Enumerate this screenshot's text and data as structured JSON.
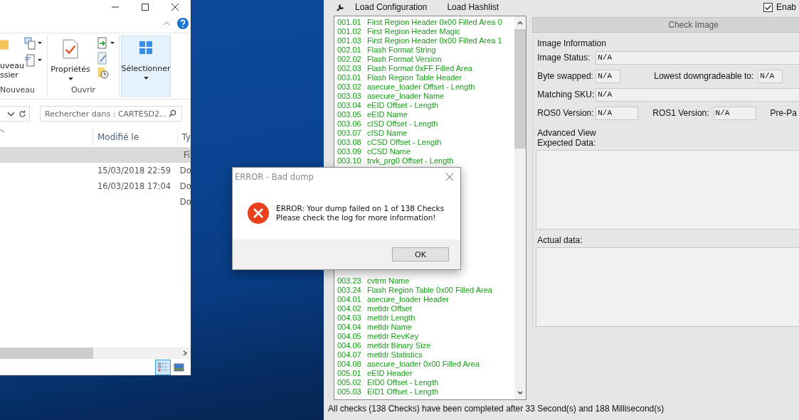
{
  "explorer": {
    "new_folder": "uveau\nssier",
    "groups": [
      {
        "label": "Nouveau"
      },
      {
        "label": "Ouvrir"
      }
    ],
    "properties": "Propriétés",
    "select": "Sélectionner",
    "search": {
      "placeholder": "Rechercher dans : CARTESD2..."
    },
    "columns": [
      "Modifié le",
      "Ty"
    ],
    "rows": [
      {
        "modified": "",
        "type": "Fi",
        "selected": true
      },
      {
        "modified": "15/03/2018 22:59",
        "type": "Do",
        "selected": false
      },
      {
        "modified": "16/03/2018 17:04",
        "type": "Do",
        "selected": false
      },
      {
        "modified": "",
        "type": "Do",
        "selected": false
      }
    ]
  },
  "app": {
    "toolbar": [
      "Load Configuration",
      "Load Hashlist"
    ],
    "option": {
      "label": "Enab",
      "checked": true
    },
    "checks_above_dialog": [
      {
        "id": "001.01",
        "name": "First Region Header 0x00 Filled Area 0"
      },
      {
        "id": "001.02",
        "name": "First Region Header Magic"
      },
      {
        "id": "001.03",
        "name": "First Region Header 0x00 Filled Area 1"
      },
      {
        "id": "002.01",
        "name": "Flash Format String"
      },
      {
        "id": "002.02",
        "name": "Flash Format Version"
      },
      {
        "id": "002.03",
        "name": "Flash Format 0xFF Filled Area"
      },
      {
        "id": "003.01",
        "name": "Flash Region Table Header"
      },
      {
        "id": "003.02",
        "name": "asecure_loader Offset - Length"
      },
      {
        "id": "003.03",
        "name": "asecure_loader Name"
      },
      {
        "id": "003.04",
        "name": "eEID Offset - Length"
      },
      {
        "id": "003.05",
        "name": "eEID Name"
      },
      {
        "id": "003.06",
        "name": "cISD Offset - Length"
      },
      {
        "id": "003.07",
        "name": "cISD Name"
      },
      {
        "id": "003.08",
        "name": "cCSD Offset - Length"
      },
      {
        "id": "003.09",
        "name": "cCSD Name"
      },
      {
        "id": "003.10",
        "name": "trvk_prg0 Offset - Length"
      }
    ],
    "checks_below_dialog": [
      {
        "id": "003.23",
        "name": "cvtrm Name"
      },
      {
        "id": "003.24",
        "name": "Flash Region Table 0x00 Filled Area"
      },
      {
        "id": "004.01",
        "name": "asecure_loader Header"
      },
      {
        "id": "004.02",
        "name": "metldr Offset"
      },
      {
        "id": "004.03",
        "name": "metldr Length"
      },
      {
        "id": "004.04",
        "name": "metldr Name"
      },
      {
        "id": "004.05",
        "name": "metldr RevKey"
      },
      {
        "id": "004.06",
        "name": "metldr Binary Size"
      },
      {
        "id": "004.07",
        "name": "metldr Statistics"
      },
      {
        "id": "004.08",
        "name": "asecure_loader 0x00 Filled Area"
      },
      {
        "id": "005.01",
        "name": "eEID Header"
      },
      {
        "id": "005.02",
        "name": "EID0 Offset - Length"
      },
      {
        "id": "005.03",
        "name": "EID1 Offset - Length"
      }
    ],
    "check_button": "Check Image",
    "image_information": {
      "title": "Image Information",
      "rows": [
        [
          {
            "kind": "wide",
            "label": "Image Status:",
            "value": "N/A"
          }
        ],
        [
          {
            "kind": "small",
            "label": "Byte swapped:",
            "value": "N/A"
          },
          {
            "kind": "small",
            "label": "Lowest downgradeable to:",
            "value": "N/A"
          }
        ],
        [
          {
            "kind": "wide",
            "label": "Matching SKU:",
            "value": "N/A"
          }
        ],
        [
          {
            "kind": "medium",
            "label": "ROS0 Version:",
            "value": "N/A"
          },
          {
            "kind": "medium",
            "label": "ROS1 Version:",
            "value": "N/A"
          },
          {
            "kind": "label_only",
            "label": "Pre-Pa"
          }
        ]
      ]
    },
    "advanced_view": {
      "title": "Advanced View",
      "expected_label": "Expected Data:",
      "actual_label": "Actual data:"
    },
    "status": "All checks (138 Checks) have been completed after 33 Second(s) and 188 Millisecond(s)"
  },
  "dialog": {
    "title": "ERROR - Bad dump",
    "message": "ERROR: Your dump failed on 1 of 138 Checks\nPlease check the log for more information!",
    "button": "OK"
  }
}
